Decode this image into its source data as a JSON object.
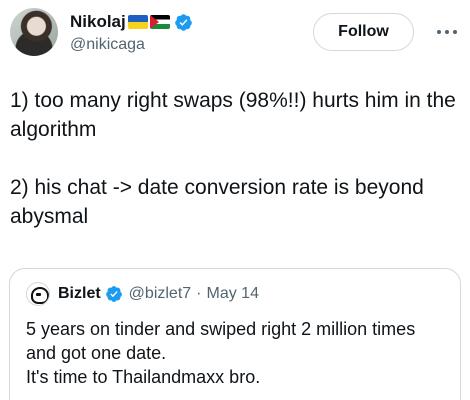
{
  "author": {
    "display_name": "Nikolaj",
    "handle": "@nikicaga",
    "flags": [
      "ukraine-flag",
      "palestine-flag"
    ],
    "verified": true
  },
  "actions": {
    "follow_label": "Follow",
    "more_icon": "more-horizontal-icon"
  },
  "tweet": {
    "line1": "1) too many right swaps (98%!!) hurts him in the algorithm",
    "line2": "2) his chat -> date conversion rate is beyond abysmal"
  },
  "quoted": {
    "display_name": "Bizlet",
    "handle": "@bizlet7",
    "separator": "·",
    "date": "May 14",
    "verified": true,
    "text_line1": "5 years on tinder and swiped right 2 million times and got one date.",
    "text_line2": "It's time to Thailandmaxx bro."
  },
  "colors": {
    "verified_badge": "#1d9bf0",
    "secondary_text": "#536471",
    "border": "#cfd9de"
  }
}
